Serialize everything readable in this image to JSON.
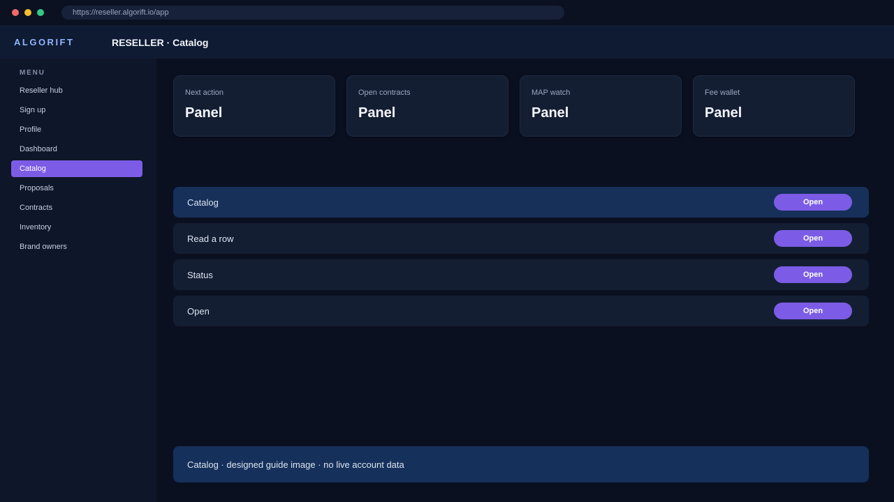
{
  "browser": {
    "url": "https://reseller.algorift.io/app"
  },
  "header": {
    "brand": "ALGORIFT",
    "title": "RESELLER · Catalog"
  },
  "sidebar": {
    "heading": "MENU",
    "items": [
      {
        "label": "Reseller hub"
      },
      {
        "label": "Sign up"
      },
      {
        "label": "Profile"
      },
      {
        "label": "Dashboard"
      },
      {
        "label": "Catalog",
        "active": true
      },
      {
        "label": "Proposals"
      },
      {
        "label": "Contracts"
      },
      {
        "label": "Inventory"
      },
      {
        "label": "Brand owners"
      }
    ]
  },
  "cards": [
    {
      "label": "Next action",
      "value": "Panel"
    },
    {
      "label": "Open contracts",
      "value": "Panel"
    },
    {
      "label": "MAP watch",
      "value": "Panel"
    },
    {
      "label": "Fee wallet",
      "value": "Panel"
    }
  ],
  "rows": [
    {
      "label": "Catalog",
      "button": "Open",
      "highlighted": true
    },
    {
      "label": "Read a row",
      "button": "Open"
    },
    {
      "label": "Status",
      "button": "Open"
    },
    {
      "label": "Open",
      "button": "Open"
    }
  ],
  "footer": {
    "text": "Catalog · designed guide image · no live account data"
  },
  "colors": {
    "accent": "#7c5ce6",
    "brand": "#8fb4ff",
    "background": "#0b1020",
    "highlight_row": "#16305a"
  }
}
